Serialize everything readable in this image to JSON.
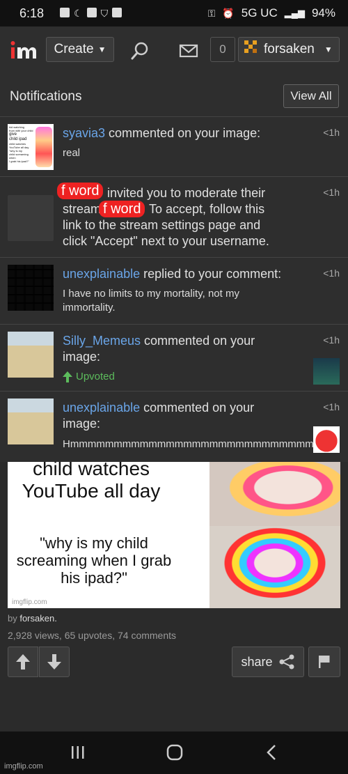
{
  "status_bar": {
    "time": "6:18",
    "network": "5G UC",
    "battery": "94%"
  },
  "nav": {
    "create_label": "Create",
    "notif_count": "0",
    "username": "forsaken"
  },
  "notifications": {
    "title": "Notifications",
    "view_all": "View All",
    "items": [
      {
        "user": "syavia3",
        "action": " commented on your image:",
        "body": "real",
        "time": "<1h",
        "thumb_lines": [
          "kid watching",
          "from with your child",
          "give",
          "child ipad",
          "child watches",
          "YouTube all day",
          "\"why is my",
          "child screaming when",
          "I grab his ipad?\""
        ]
      },
      {
        "line1": "invited you to moderate their",
        "line2a": "stream.",
        "line2b": "To accept, follow this",
        "line3": "link to the stream settings page and",
        "line4": "click \"Accept\" next to your username.",
        "redact1": "f word",
        "redact2": "f word",
        "time": "<1h"
      },
      {
        "user": "unexplainable",
        "action": " replied to your comment:",
        "body": "I have no limits to my mortality, not my immortality.",
        "time": "<1h"
      },
      {
        "user": "Silly_Memeus",
        "action": " commented on your image:",
        "upvoted": "Upvoted",
        "time": "<1h"
      },
      {
        "user": "unexplainable",
        "action": " commented on your image:",
        "body": "Hmmmmmmmmmmmmmmmmmmmmmmmmmmmmmmm",
        "time": "<1h"
      }
    ]
  },
  "meme": {
    "text_top": "child watches YouTube all day",
    "text_bottom": "\"why is my child screaming when I grab his ipad?\"",
    "watermark": "imgflip.com"
  },
  "post": {
    "by_prefix": "by ",
    "author": "forsaken.",
    "stats": "2,928 views, 65 upvotes, 74 comments",
    "share_label": "share"
  },
  "footer_watermark": "imgflip.com",
  "colors": {
    "accent_blue": "#6aa5e8",
    "upvote_green": "#5cbc5c",
    "redact_red": "#e22222"
  }
}
